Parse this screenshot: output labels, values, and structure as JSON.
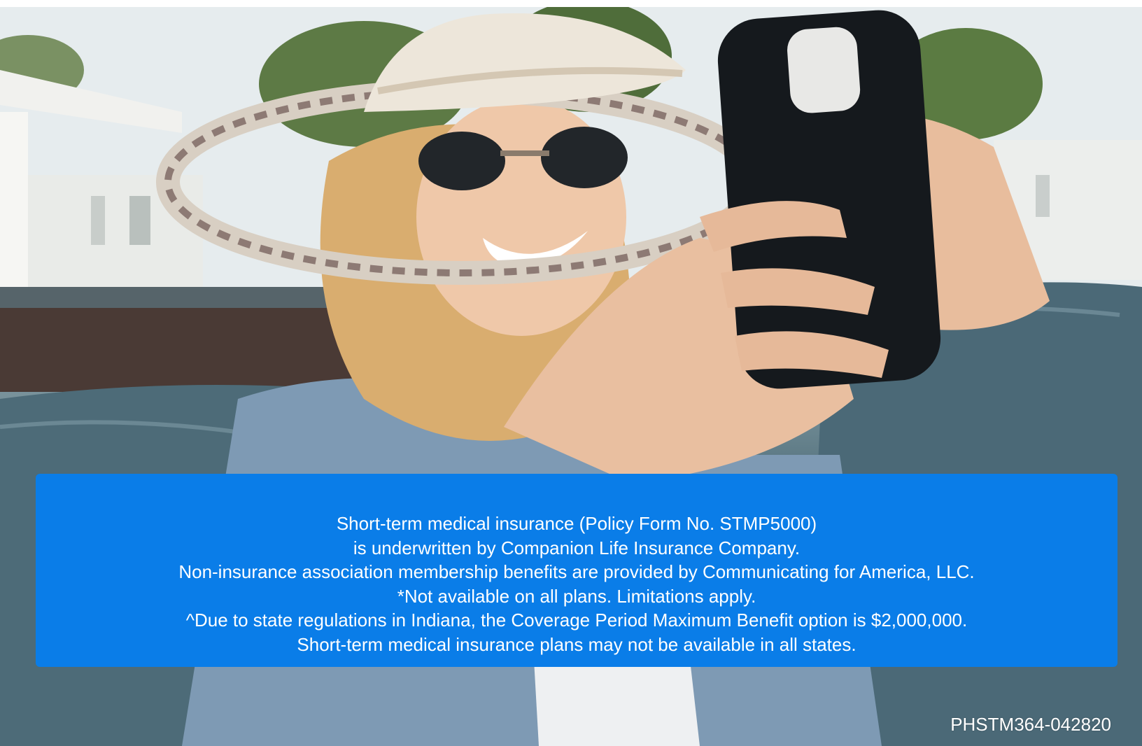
{
  "hero_image": {
    "subject": "woman-in-sun-hat-with-phone-icon"
  },
  "disclaimer": {
    "background_color": "#0a7de8",
    "text_color": "#ffffff",
    "lines": [
      "Short-term medical insurance (Policy Form No. STMP5000)",
      "is underwritten by Companion Life Insurance Company.",
      "Non-insurance association membership benefits are provided by Communicating for America, LLC.",
      "*Not available on all plans. Limitations apply.",
      "^Due to state regulations in Indiana, the Coverage Period Maximum Benefit option is $2,000,000.",
      "Short-term medical insurance plans may not be available in all states."
    ]
  },
  "form_code": "PHSTM364-042820"
}
